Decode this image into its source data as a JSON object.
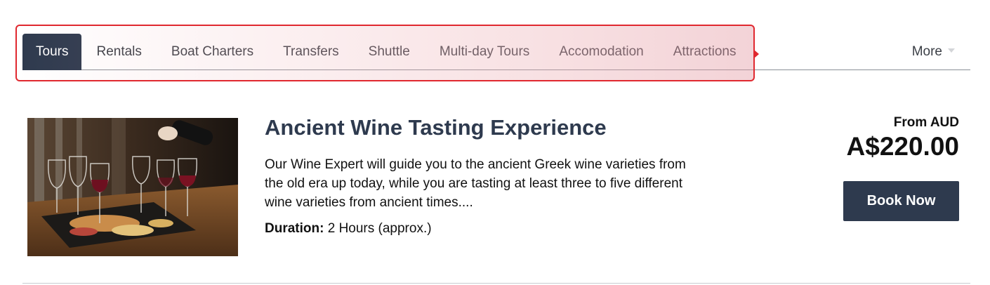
{
  "tabs": [
    {
      "label": "Tours",
      "active": true
    },
    {
      "label": "Rentals",
      "active": false
    },
    {
      "label": "Boat Charters",
      "active": false
    },
    {
      "label": "Transfers",
      "active": false
    },
    {
      "label": "Shuttle",
      "active": false
    },
    {
      "label": "Multi-day Tours",
      "active": false
    },
    {
      "label": "Accomodation",
      "active": false
    },
    {
      "label": "Attractions",
      "active": false
    }
  ],
  "more": {
    "label": "More",
    "icon": "chevron-down-icon"
  },
  "listing": {
    "image_alt": "wine glasses and food platter",
    "title": "Ancient Wine Tasting Experience",
    "description": "Our Wine Expert will guide you to the ancient Greek wine varieties from the old era up today, while you are tasting at least three to five different wine varieties from ancient times....",
    "duration_label": "Duration:",
    "duration_value": "2 Hours (approx.)",
    "price_prefix": "From AUD",
    "price": "A$220.00",
    "book_label": "Book Now"
  },
  "colors": {
    "primary": "#2e3a4e",
    "highlight": "#e0282f"
  }
}
